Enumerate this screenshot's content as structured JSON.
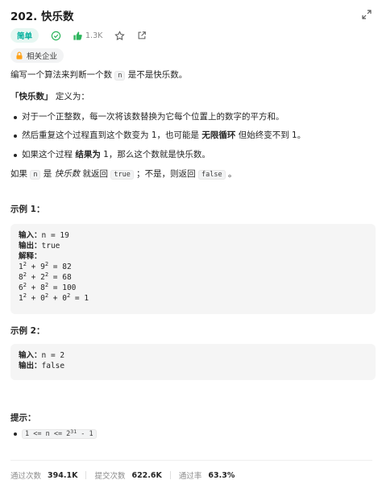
{
  "problem": {
    "title": "202. 快乐数",
    "difficulty": "简单",
    "likes": "1.3K",
    "company_tag": "相关企业"
  },
  "description": {
    "intro_before": "编写一个算法来判断一个数 ",
    "intro_code": "n",
    "intro_after": " 是不是快乐数。",
    "def_bold": "「快乐数」",
    "def_rest": " 定义为：",
    "rules": [
      "对于一个正整数，每一次将该数替换为它每个位置上的数字的平方和。",
      "然后重复这个过程直到这个数变为 1，也可能是 ",
      "如果这个过程 "
    ],
    "rule2_bold": "无限循环",
    "rule2_rest": " 但始终变不到 1。",
    "rule3_bold": "结果为",
    "rule3_rest": " 1，那么这个数就是快乐数。",
    "ret_prefix": "如果 ",
    "ret_code_n": "n",
    "ret_mid": " 是 ",
    "ret_ital": "快乐数",
    "ret_after": " 就返回 ",
    "ret_true": "true",
    "ret_mid2": " ；不是，则返回 ",
    "ret_false": "false",
    "ret_end": " 。"
  },
  "example1": {
    "heading": "示例 1：",
    "input_label": "输入：",
    "input_value": "n = 19",
    "output_label": "输出：",
    "output_value": "true",
    "explain_label": "解释："
  },
  "example2": {
    "heading": "示例 2：",
    "input_label": "输入：",
    "input_value": "n = 2",
    "output_label": "输出：",
    "output_value": "false"
  },
  "hints": {
    "title": "提示：",
    "constraint_pre": "1 <= n <= 2",
    "constraint_exp": "31",
    "constraint_post": " - 1"
  },
  "stats": {
    "accepted_label": "通过次数",
    "accepted_value": "394.1K",
    "submitted_label": "提交次数",
    "submitted_value": "622.6K",
    "rate_label": "通过率",
    "rate_value": "63.3%"
  },
  "colors": {
    "easy": "#00af9b",
    "like": "#2db55d"
  }
}
